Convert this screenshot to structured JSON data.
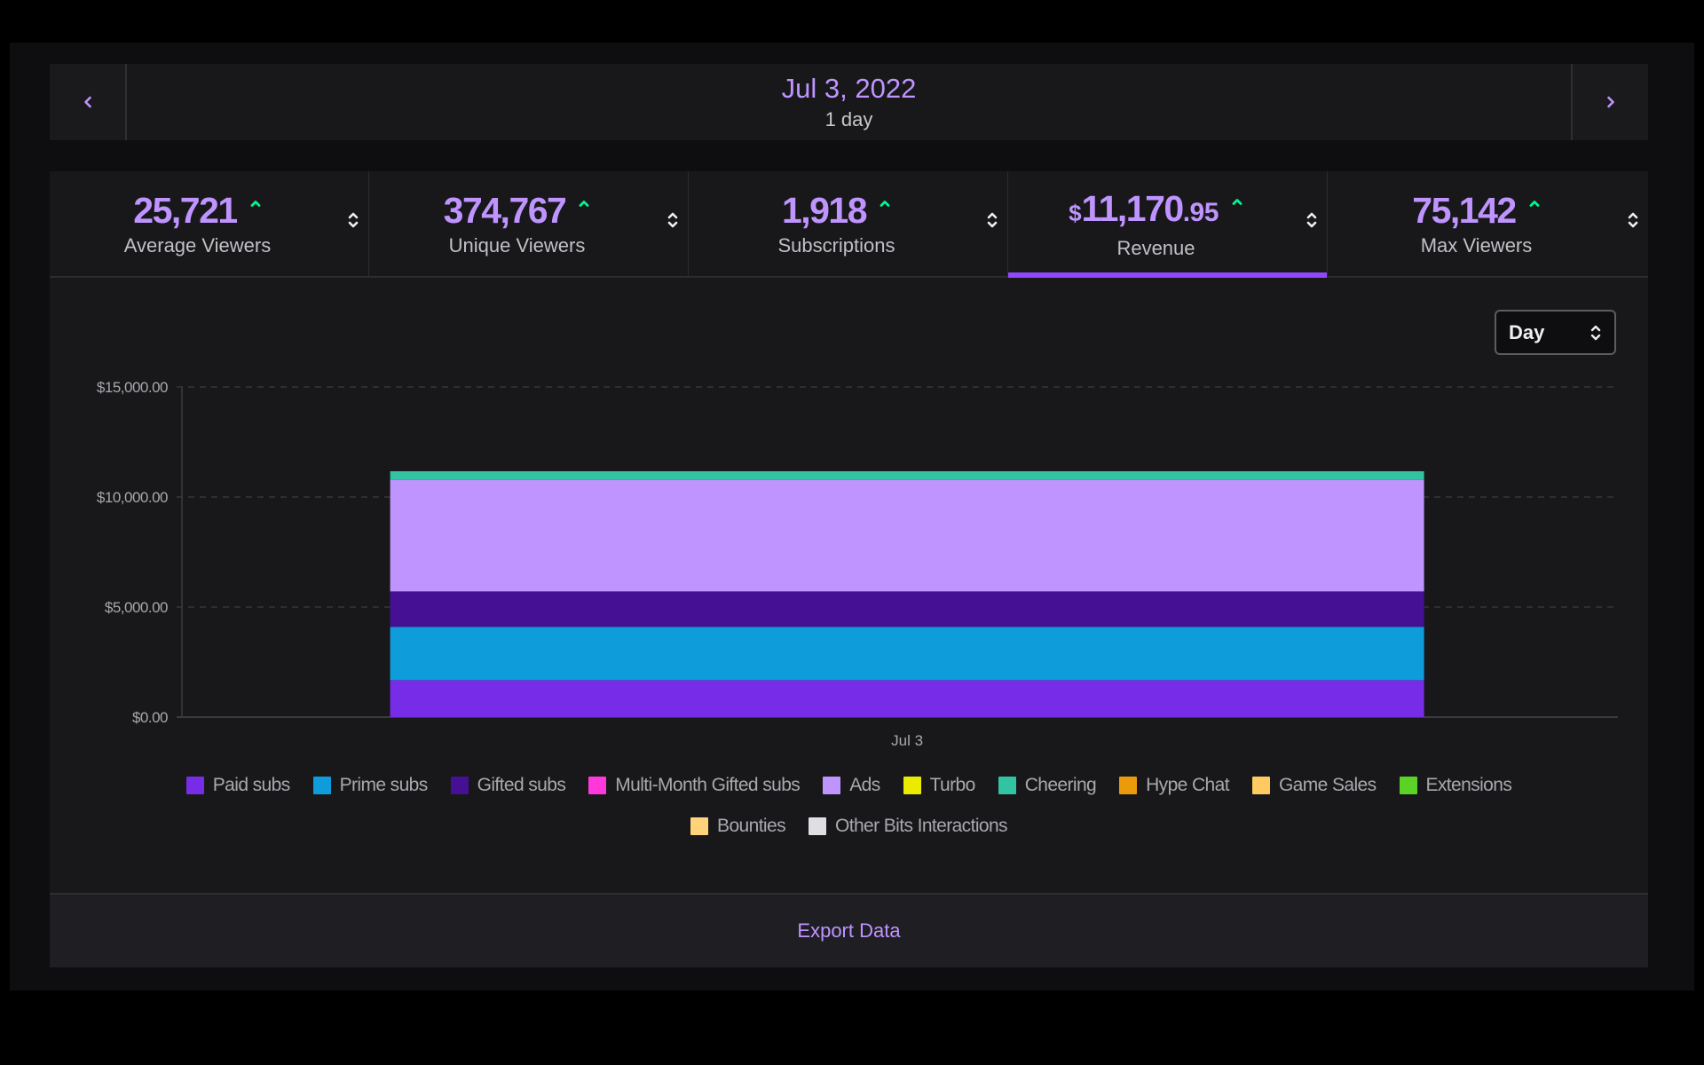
{
  "date_nav": {
    "prev_icon": "chevron-left-icon",
    "next_icon": "chevron-right-icon",
    "title": "Jul 3, 2022",
    "range": "1 day"
  },
  "stats": [
    {
      "currency": "",
      "value": "25,721",
      "cents": "",
      "label": "Average Viewers",
      "trend": "up",
      "selected": false
    },
    {
      "currency": "",
      "value": "374,767",
      "cents": "",
      "label": "Unique Viewers",
      "trend": "up",
      "selected": false
    },
    {
      "currency": "",
      "value": "1,918",
      "cents": "",
      "label": "Subscriptions",
      "trend": "up",
      "selected": false
    },
    {
      "currency": "$",
      "value": "11,170",
      "cents": ".95",
      "label": "Revenue",
      "trend": "up",
      "selected": true
    },
    {
      "currency": "",
      "value": "75,142",
      "cents": "",
      "label": "Max Viewers",
      "trend": "up",
      "selected": false
    }
  ],
  "colors": {
    "accent": "#bf94ff",
    "selected_underline": "#9147ff",
    "trend_up": "#00f593"
  },
  "granularity_select": {
    "value": "Day"
  },
  "chart_data": {
    "type": "bar",
    "stacked": true,
    "title": "",
    "xlabel": "",
    "ylabel": "",
    "categories": [
      "Jul 3"
    ],
    "ylim": [
      0,
      15000
    ],
    "yticks": [
      0,
      5000,
      10000,
      15000
    ],
    "ytick_labels": [
      "$0.00",
      "$5,000.00",
      "$10,000.00",
      "$15,000.00"
    ],
    "grid": true,
    "legend_position": "bottom",
    "series": [
      {
        "name": "Paid subs",
        "color": "#772ce8",
        "values": [
          1680
        ]
      },
      {
        "name": "Prime subs",
        "color": "#0e9cdb",
        "values": [
          2420
        ]
      },
      {
        "name": "Gifted subs",
        "color": "#451093",
        "values": [
          1610
        ]
      },
      {
        "name": "Multi-Month Gifted subs",
        "color": "#ff38db",
        "values": [
          0
        ]
      },
      {
        "name": "Ads",
        "color": "#bf94ff",
        "values": [
          5060
        ]
      },
      {
        "name": "Turbo",
        "color": "#ebeb00",
        "values": [
          0
        ]
      },
      {
        "name": "Cheering",
        "color": "#32c3a2",
        "values": [
          400
        ]
      },
      {
        "name": "Hype Chat",
        "color": "#eb9a0c",
        "values": [
          0
        ]
      },
      {
        "name": "Game Sales",
        "color": "#ffca5f",
        "values": [
          0
        ]
      },
      {
        "name": "Extensions",
        "color": "#5ad226",
        "values": [
          0
        ]
      },
      {
        "name": "Bounties",
        "color": "#ffd37a",
        "values": [
          0
        ]
      },
      {
        "name": "Other Bits Interactions",
        "color": "#dedee3",
        "values": [
          0
        ]
      }
    ]
  },
  "footer": {
    "export_label": "Export Data"
  }
}
